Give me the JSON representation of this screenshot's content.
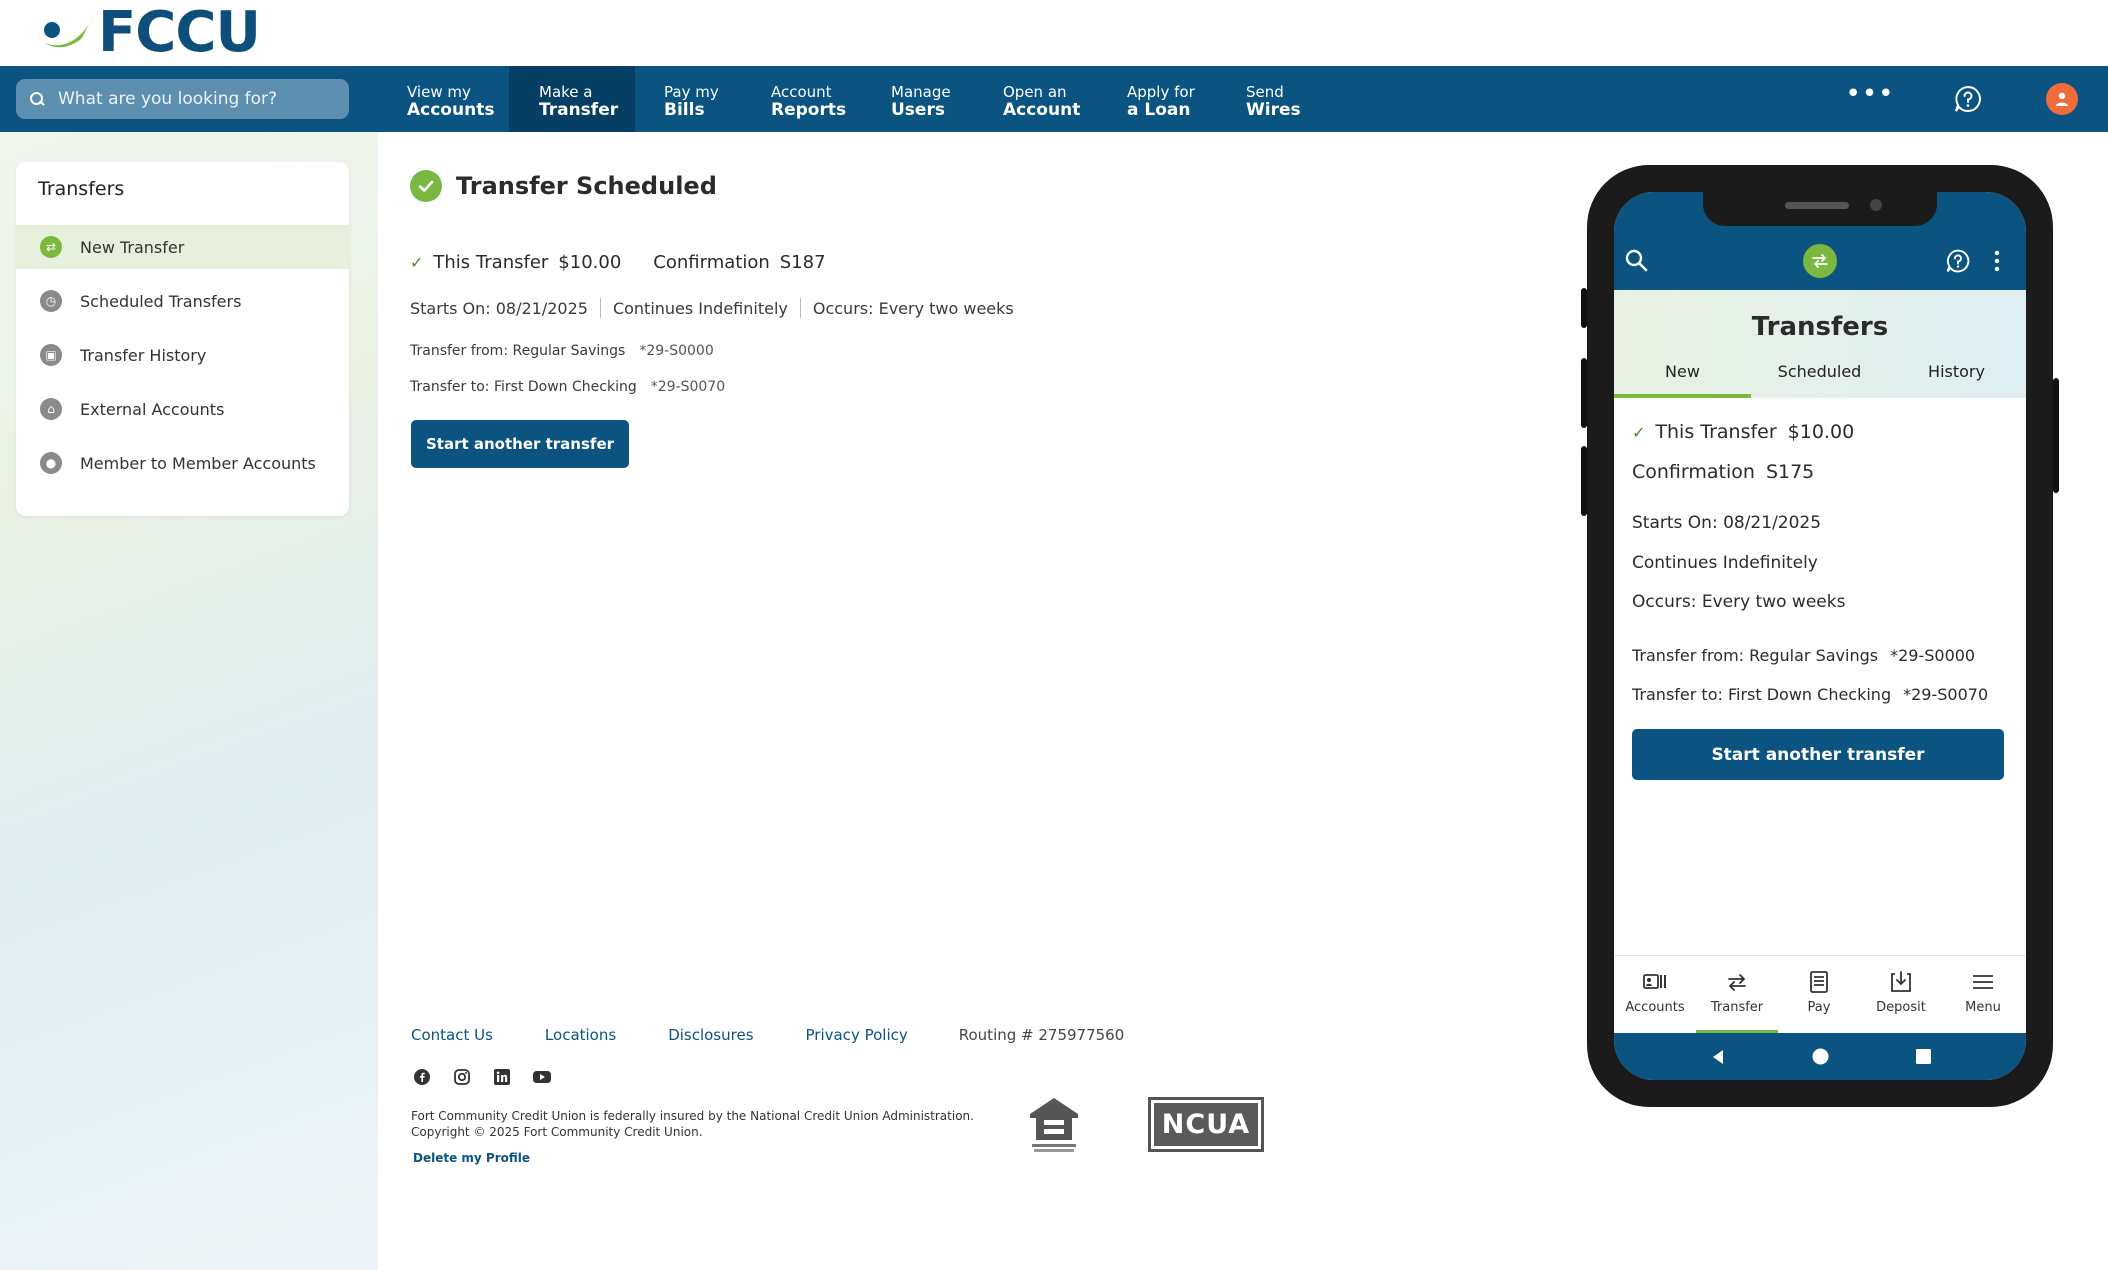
{
  "brand": {
    "name": "FCCU",
    "primary": "#0b5381",
    "accent": "#7ab83f",
    "profile": "#f26b3a"
  },
  "search": {
    "placeholder": "What are you looking for?"
  },
  "nav": {
    "items": [
      {
        "line1": "View my",
        "line2": "Accounts"
      },
      {
        "line1": "Make a",
        "line2": "Transfer"
      },
      {
        "line1": "Pay my",
        "line2": "Bills"
      },
      {
        "line1": "Account",
        "line2": "Reports"
      },
      {
        "line1": "Manage",
        "line2": "Users"
      },
      {
        "line1": "Open an",
        "line2": "Account"
      },
      {
        "line1": "Apply for",
        "line2": "a Loan"
      },
      {
        "line1": "Send",
        "line2": "Wires"
      }
    ],
    "more": "•••"
  },
  "sidebar": {
    "title": "Transfers",
    "items": [
      {
        "label": "New Transfer",
        "icon": "transfer-icon"
      },
      {
        "label": "Scheduled Transfers",
        "icon": "clock-icon"
      },
      {
        "label": "Transfer History",
        "icon": "history-icon"
      },
      {
        "label": "External Accounts",
        "icon": "bank-icon"
      },
      {
        "label": "Member to Member Accounts",
        "icon": "members-icon"
      }
    ]
  },
  "main": {
    "title": "Transfer Scheduled",
    "this_transfer_label": "This Transfer",
    "amount": "$10.00",
    "confirmation_label": "Confirmation",
    "confirmation": "S187",
    "starts_on": "Starts On: 08/21/2025",
    "continues": "Continues Indefinitely",
    "occurs": "Occurs: Every two weeks",
    "from_label": "Transfer from: Regular Savings",
    "from_acct": "*29-S0000",
    "to_label": "Transfer to: First Down Checking",
    "to_acct": "*29-S0070",
    "button": "Start another transfer"
  },
  "footer": {
    "links": [
      "Contact Us",
      "Locations",
      "Disclosures",
      "Privacy Policy"
    ],
    "routing": "Routing # 275977560",
    "legal1": "Fort Community Credit Union is federally insured by the National Credit Union Administration.",
    "legal2": "Copyright © 2025 Fort Community Credit Union.",
    "delete": "Delete my Profile",
    "ncua": "NCUA"
  },
  "phone": {
    "title": "Transfers",
    "tabs": [
      "New",
      "Scheduled",
      "History"
    ],
    "this_transfer_label": "This Transfer",
    "amount": "$10.00",
    "confirmation_label": "Confirmation",
    "confirmation": "S175",
    "starts_on": "Starts On: 08/21/2025",
    "continues": "Continues Indefinitely",
    "occurs": "Occurs: Every two weeks",
    "from_label": "Transfer from: Regular Savings",
    "from_acct": "*29-S0000",
    "to_label": "Transfer to: First Down Checking",
    "to_acct": "*29-S0070",
    "button": "Start another transfer",
    "bottom_nav": [
      "Accounts",
      "Transfer",
      "Pay",
      "Deposit",
      "Menu"
    ]
  }
}
